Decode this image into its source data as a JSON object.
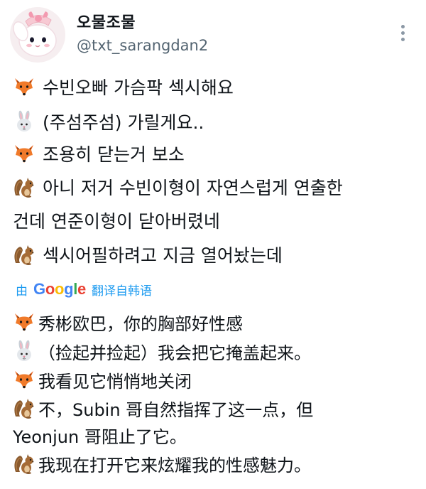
{
  "author": {
    "display_name": "오물조물",
    "handle": "@txt_sarangdan2"
  },
  "icons": {
    "more": "more-vertical-icon",
    "fox": "fox-emoji",
    "rabbit": "rabbit-emoji",
    "squirrel": "chipmunk-emoji"
  },
  "tweet": {
    "lines": [
      {
        "emoji": "fox",
        "text": "수빈오빠 가슴팍 섹시해요"
      },
      {
        "emoji": "rabbit",
        "text": "(주섬주섬) 가릴게요.."
      },
      {
        "emoji": "fox",
        "text": "조용히 닫는거 보소"
      },
      {
        "emoji": "squirrel",
        "text": "아니 저거 수빈이형이 자연스럽게 연출한"
      },
      {
        "emoji": "",
        "text": "건데 연준이형이 닫아버렸네"
      },
      {
        "emoji": "squirrel",
        "text": "섹시어필하려고 지금 열어놨는데"
      }
    ]
  },
  "translation_bar": {
    "by": "由",
    "provider": "Google",
    "label": "翻译自韩语"
  },
  "translation": {
    "lines": [
      {
        "emoji": "fox",
        "text": "秀彬欧巴，你的胸部好性感"
      },
      {
        "emoji": "rabbit",
        "text": "（捡起并捡起）我会把它掩盖起来。"
      },
      {
        "emoji": "fox",
        "text": "我看见它悄悄地关闭"
      },
      {
        "emoji": "squirrel",
        "text": "不，Subin 哥自然指挥了这一点，但"
      },
      {
        "emoji": "",
        "text": "Yeonjun 哥阻止了它。"
      },
      {
        "emoji": "squirrel",
        "text": "我现在打开它来炫耀我的性感魅力。"
      }
    ]
  },
  "colors": {
    "text": "#0f1419",
    "secondary": "#536471",
    "link": "#1d9bf0",
    "google_blue": "#4285f4",
    "google_red": "#ea4335",
    "google_yellow": "#fbbc05",
    "google_green": "#34a853"
  }
}
